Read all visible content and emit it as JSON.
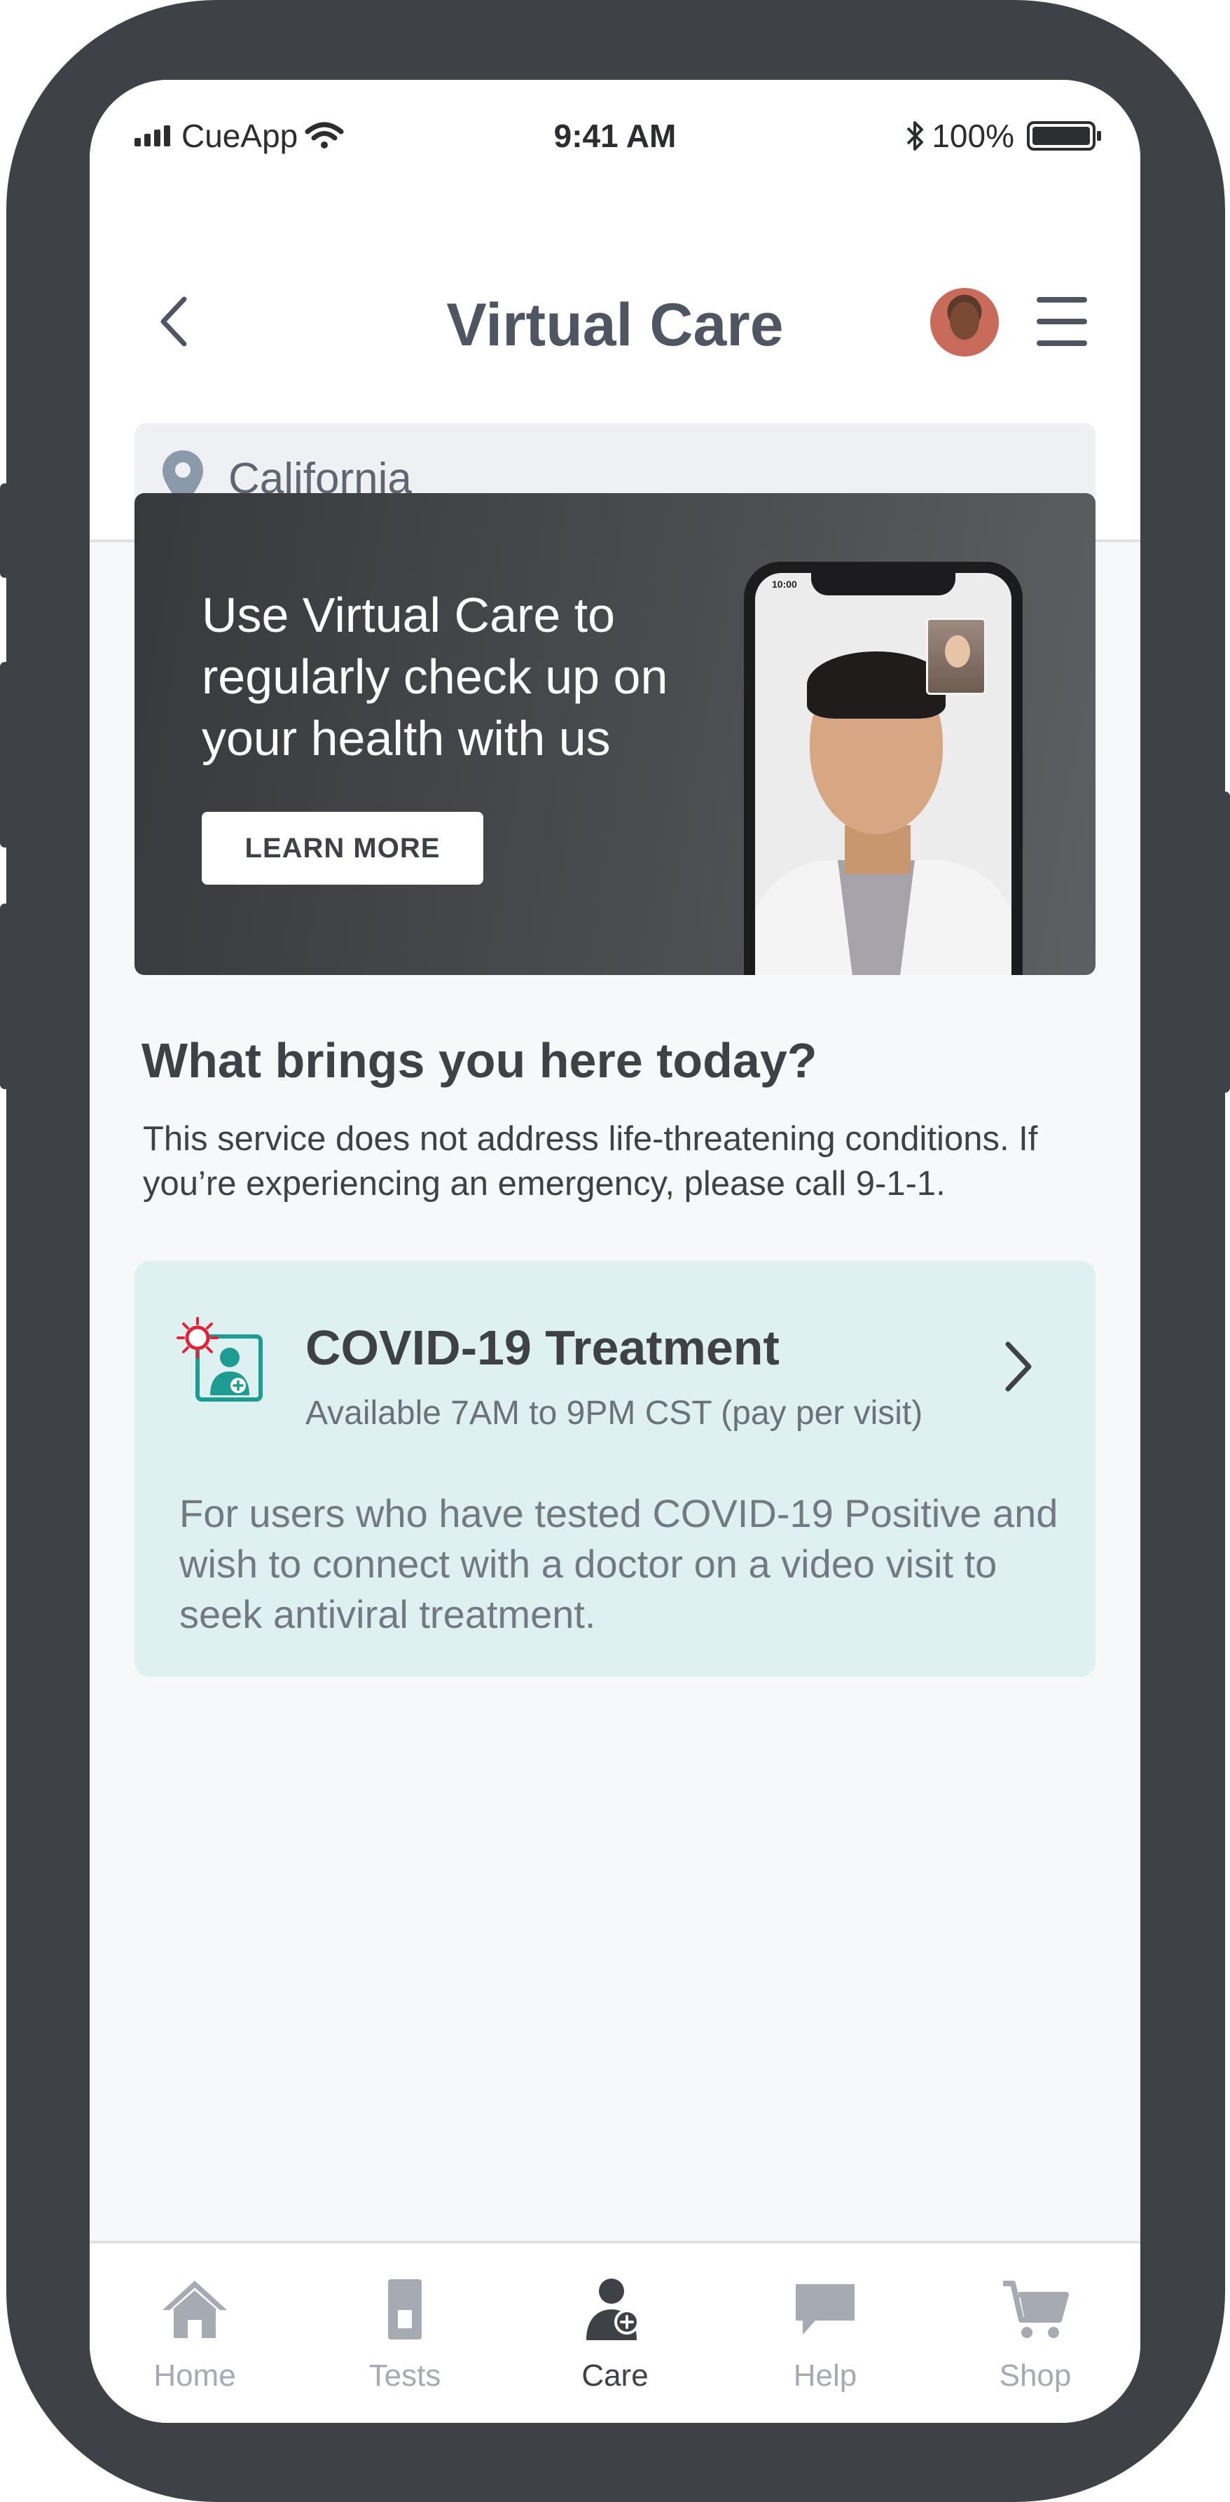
{
  "status_bar": {
    "carrier": "CueApp",
    "time": "9:41 AM",
    "battery": "100%"
  },
  "header": {
    "title": "Virtual Care",
    "location": "California"
  },
  "banner": {
    "headline": "Use Virtual Care to regularly check up on your health with us",
    "cta_label": "LEARN MORE",
    "mock_phone_time": "10:00"
  },
  "intro": {
    "title": "What brings you here today?",
    "description": "This service does not address life-threatening conditions. If you’re experiencing an emergency, please call 9-1-1."
  },
  "services": [
    {
      "title": "COVID-19 Treatment",
      "subtitle": "Available 7AM to 9PM CST (pay per visit)",
      "description": "For users who have tested COVID-19 Positive and wish to connect with a doctor on a video visit to seek antiviral treatment.",
      "icon": "covid-doctor-icon"
    }
  ],
  "tab_bar": {
    "items": [
      {
        "label": "Home",
        "icon": "home-icon",
        "active": false
      },
      {
        "label": "Tests",
        "icon": "test-cartridge-icon",
        "active": false
      },
      {
        "label": "Care",
        "icon": "care-icon",
        "active": true
      },
      {
        "label": "Help",
        "icon": "chat-bubble-icon",
        "active": false
      },
      {
        "label": "Shop",
        "icon": "cart-icon",
        "active": false
      }
    ]
  },
  "colors": {
    "frame": "#3e4146",
    "accent_teal": "#1d9c94",
    "virus_red": "#e0233b",
    "card_bg": "#dff0f0",
    "inactive_tab": "#a6aab2"
  }
}
